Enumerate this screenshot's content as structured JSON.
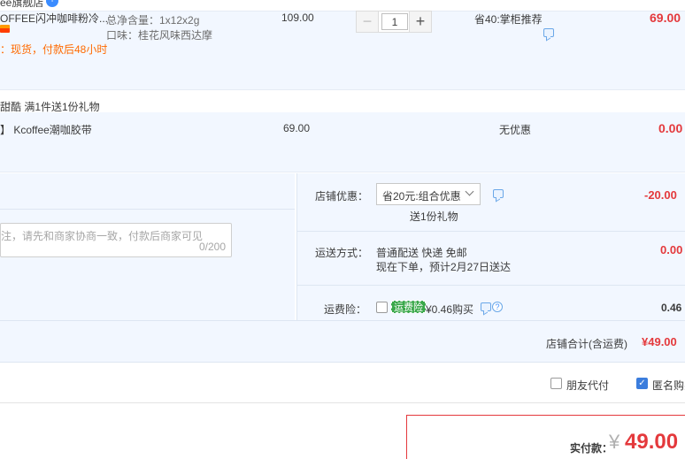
{
  "store": {
    "name": "ee旗舰店",
    "badge": "+"
  },
  "item": {
    "title": "OFFEE闪冲咖啡粉冷...",
    "stock_note": "：现货，付款后48小时",
    "sku_weight": "总净含量：1x12x2g",
    "sku_flavor": "口味：桂花风味西达摩",
    "unit_price": "109.00",
    "quantity": "1",
    "minus_label": "−",
    "plus_label": "+",
    "discount": "省40:掌柜推荐",
    "subtotal": "69.00"
  },
  "promo": {
    "text": "甜酷    满1件送1份礼物"
  },
  "gift": {
    "name": "】 Kcoffee潮咖胶带",
    "price": "69.00",
    "discount": "无优惠",
    "subtotal": "0.00"
  },
  "message": {
    "placeholder": "注，请先和商家协商一致，付款后商家可见",
    "counter": "0/200"
  },
  "shop_discount": {
    "label": "店铺优惠：",
    "selected": "省20元:组合优惠",
    "gift_note": "送1份礼物",
    "amount": "-20.00"
  },
  "shipping": {
    "label": "运送方式：",
    "method": "普通配送 快递 免邮",
    "eta": "现在下单，预计2月27日送达",
    "amount": "0.00"
  },
  "insurance": {
    "label": "运费险：",
    "badge": "运费险",
    "price": "¥0.46购买",
    "help": "?",
    "amount": "0.46"
  },
  "store_total": {
    "label": "店铺合计(含运费)",
    "amount": "¥49.00"
  },
  "options": {
    "friend_pay": "朋友代付",
    "anonymous": "匿名购买",
    "check_mark": "✓"
  },
  "payment": {
    "label": "实付款：",
    "currency": "¥",
    "amount": "49.00"
  },
  "colors": {
    "accent_red": "#e4393c",
    "row_bg": "#f2f7ff",
    "checkbox_blue": "#3b7ddd",
    "insurance_green": "#3aa84a"
  }
}
